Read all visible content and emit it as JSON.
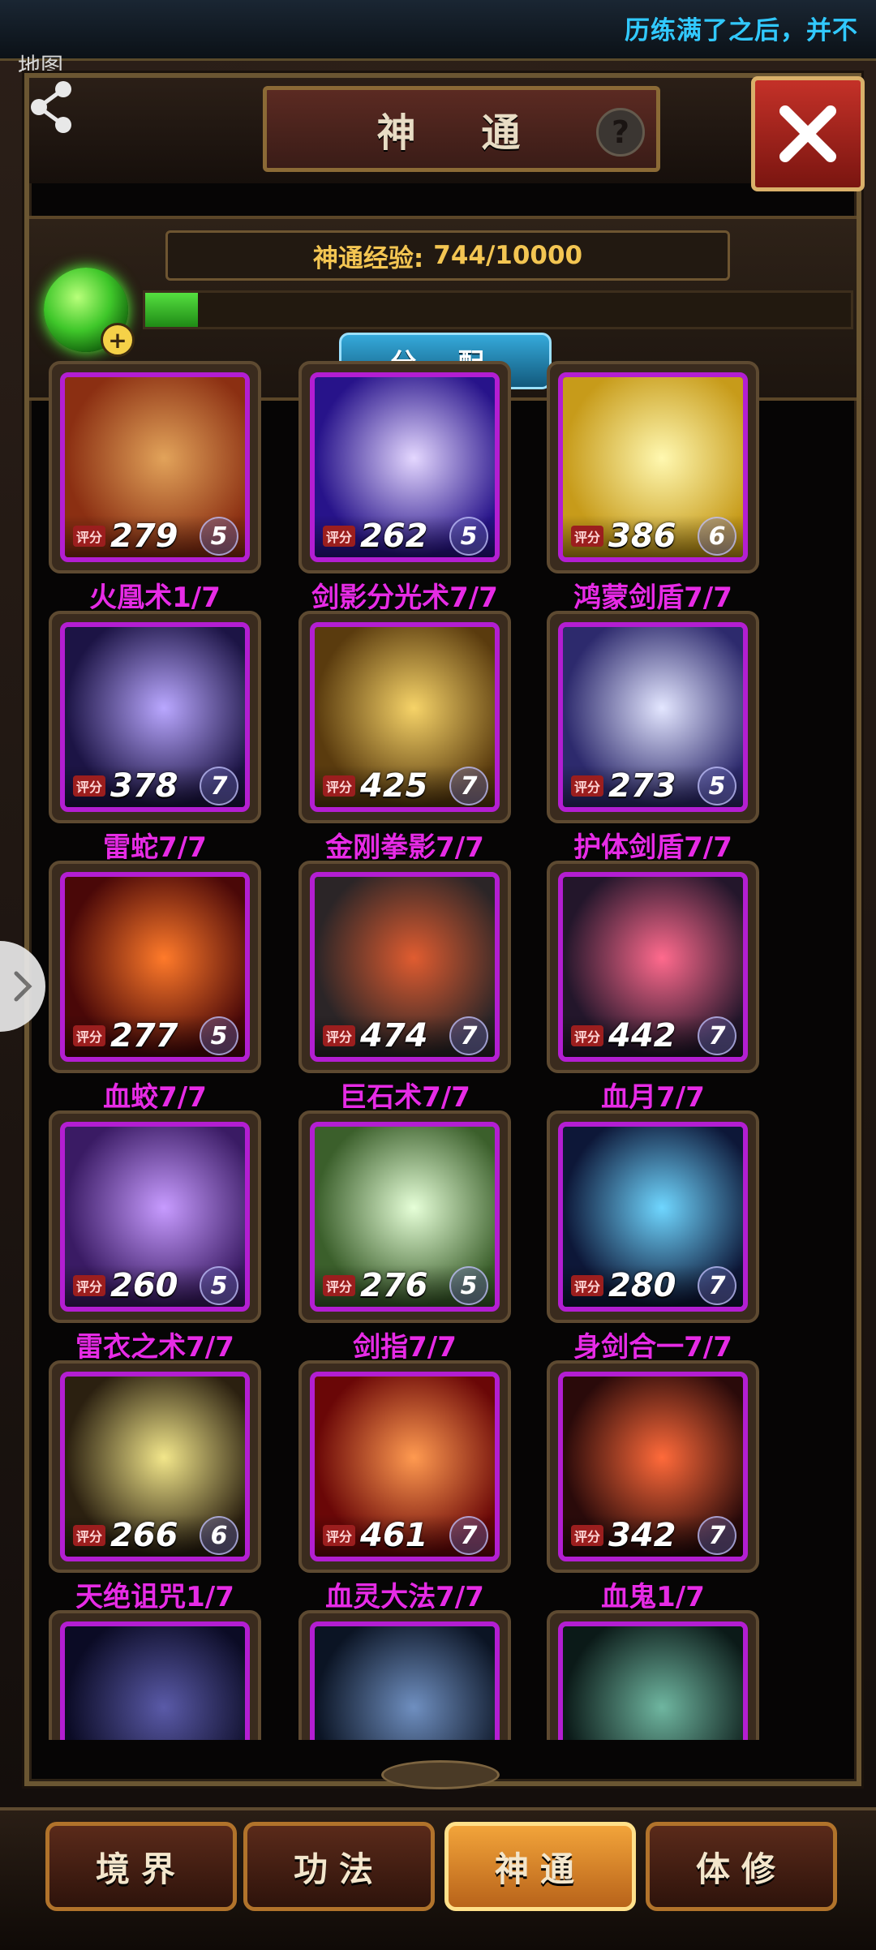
{
  "marquee": {
    "text": "历练满了之后，并不"
  },
  "map_label": "地图",
  "header": {
    "title": "神 通",
    "help": "?"
  },
  "exp": {
    "label": "神通经验:",
    "value": "744/10000",
    "fill_fraction": 0.0744
  },
  "assign_label": "分 配",
  "score_tag": "评分",
  "skills": [
    {
      "name": "火凰术1/7",
      "score": "279",
      "level": "5",
      "colors": [
        "#e2a35a",
        "#8b2f12"
      ]
    },
    {
      "name": "剑影分光术7/7",
      "score": "262",
      "level": "5",
      "colors": [
        "#e4d7ff",
        "#27138a"
      ]
    },
    {
      "name": "鸿蒙剑盾7/7",
      "score": "386",
      "level": "6",
      "colors": [
        "#fff8b0",
        "#c79b1a"
      ]
    },
    {
      "name": "雷蛇7/7",
      "score": "378",
      "level": "7",
      "colors": [
        "#b9a7ff",
        "#1c1445"
      ]
    },
    {
      "name": "金刚拳影7/7",
      "score": "425",
      "level": "7",
      "colors": [
        "#f6d368",
        "#5a3b0e"
      ]
    },
    {
      "name": "护体剑盾7/7",
      "score": "273",
      "level": "5",
      "colors": [
        "#e3e6ff",
        "#2d2a6d"
      ]
    },
    {
      "name": "血蛟7/7",
      "score": "277",
      "level": "5",
      "colors": [
        "#ff7a2a",
        "#4a0808"
      ]
    },
    {
      "name": "巨石术7/7",
      "score": "474",
      "level": "7",
      "colors": [
        "#e05c30",
        "#2b2527"
      ]
    },
    {
      "name": "血月7/7",
      "score": "442",
      "level": "7",
      "colors": [
        "#ff6a8d",
        "#23162b"
      ]
    },
    {
      "name": "雷衣之术7/7",
      "score": "260",
      "level": "5",
      "colors": [
        "#c79bff",
        "#3a1b64"
      ]
    },
    {
      "name": "剑指7/7",
      "score": "276",
      "level": "5",
      "colors": [
        "#e6ffd8",
        "#3b5f2b"
      ]
    },
    {
      "name": "身剑合一7/7",
      "score": "280",
      "level": "7",
      "colors": [
        "#6fd6ff",
        "#0d1738"
      ]
    },
    {
      "name": "天绝诅咒1/7",
      "score": "266",
      "level": "6",
      "colors": [
        "#f2e68a",
        "#2b2010"
      ]
    },
    {
      "name": "血灵大法7/7",
      "score": "461",
      "level": "7",
      "colors": [
        "#ff9a50",
        "#6a0707"
      ]
    },
    {
      "name": "血鬼1/7",
      "score": "342",
      "level": "7",
      "colors": [
        "#ff6a3a",
        "#2a0a0a"
      ]
    },
    {
      "name": "",
      "score": "",
      "level": "",
      "colors": [
        "#5a5aa8",
        "#0b0b25"
      ]
    },
    {
      "name": "",
      "score": "",
      "level": "",
      "colors": [
        "#6f8fc0",
        "#0b1424"
      ]
    },
    {
      "name": "",
      "score": "",
      "level": "",
      "colors": [
        "#6fb6a0",
        "#0b1a18"
      ]
    }
  ],
  "tabs": [
    {
      "label": "境界",
      "active": false
    },
    {
      "label": "功法",
      "active": false
    },
    {
      "label": "神通",
      "active": true
    },
    {
      "label": "体修",
      "active": false
    }
  ]
}
